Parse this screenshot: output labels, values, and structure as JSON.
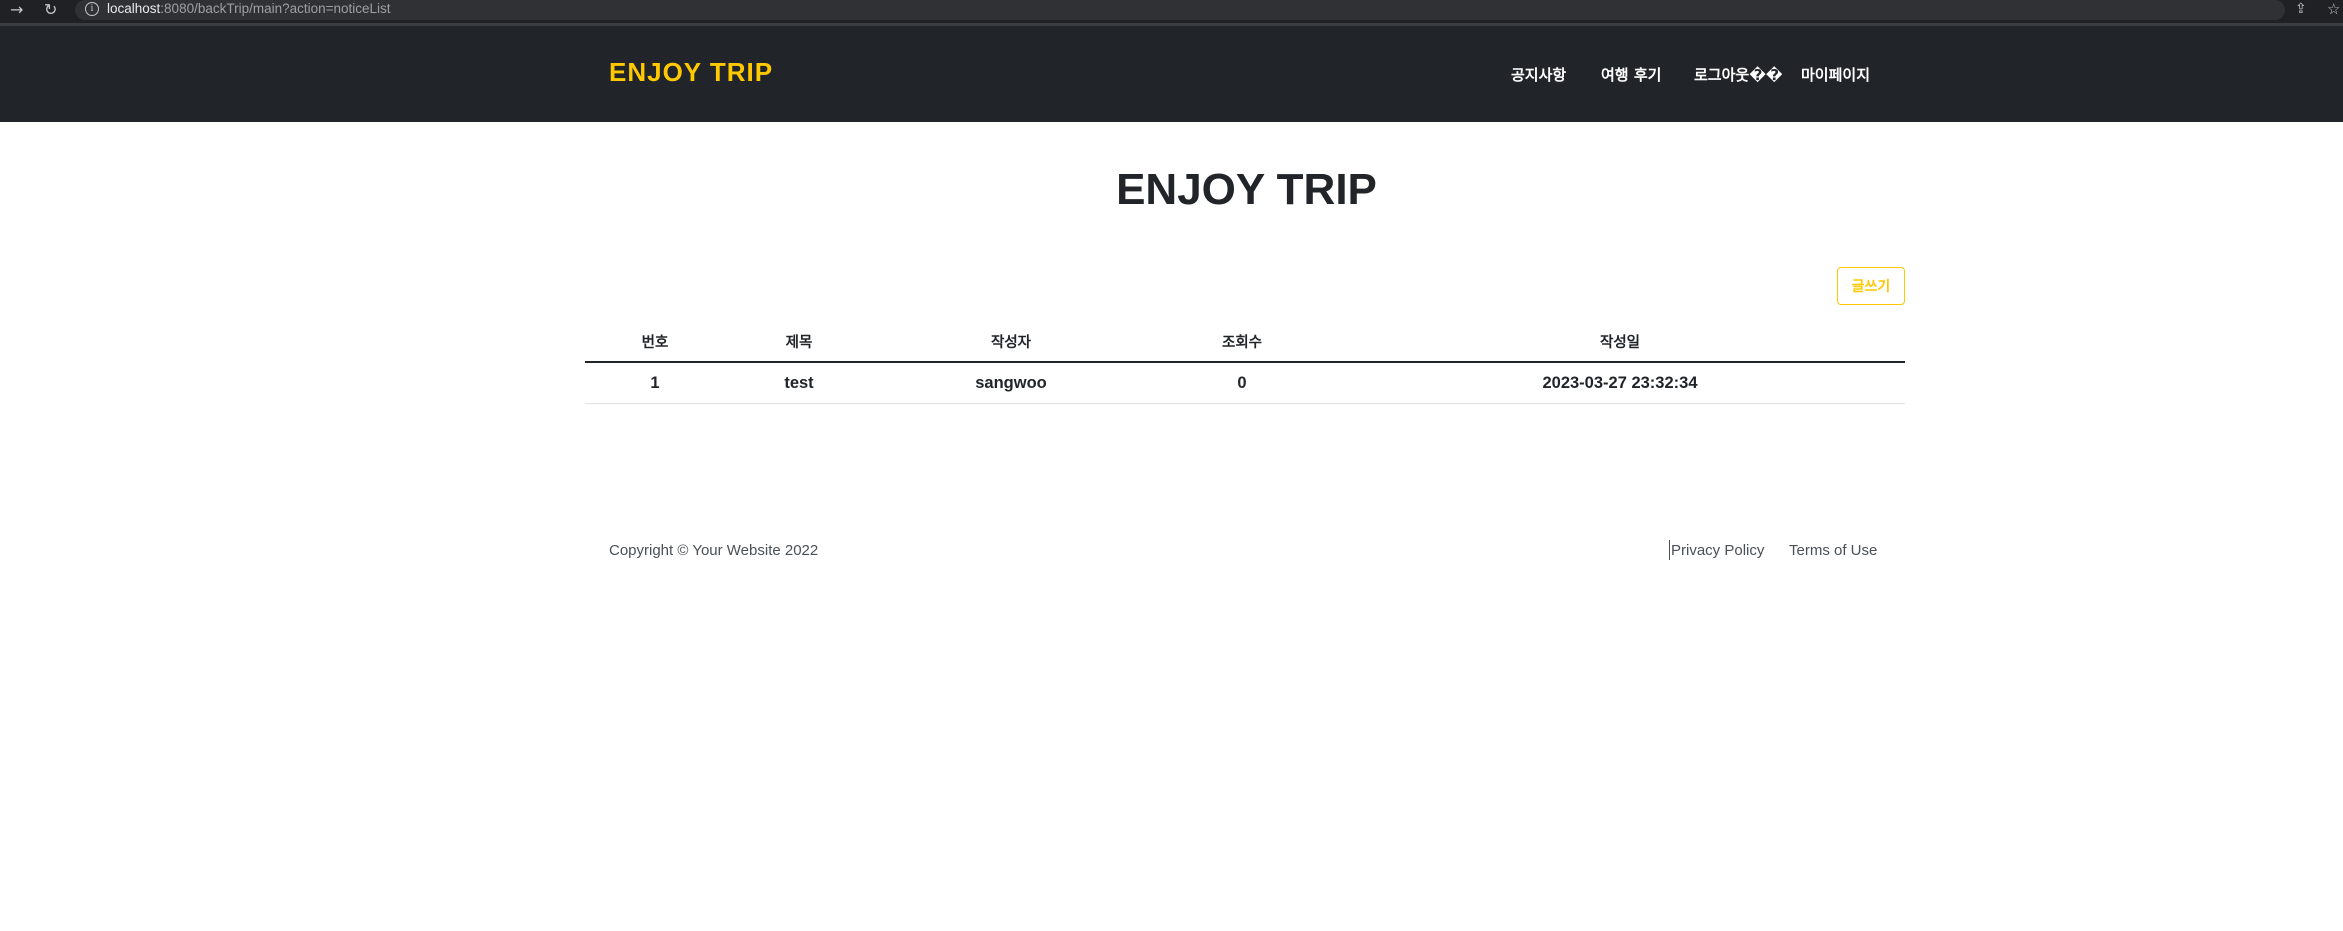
{
  "browser": {
    "url_host": "localhost",
    "url_rest": ":8080/backTrip/main?action=noticeList"
  },
  "navbar": {
    "brand": "ENJOY TRIP",
    "items": [
      {
        "label": "공지사항"
      },
      {
        "label": "여행 후기"
      },
      {
        "label": "로그아웃��"
      },
      {
        "label": "마이페이지"
      }
    ]
  },
  "main": {
    "title": "ENJOY TRIP",
    "write_button": "글쓰기",
    "table": {
      "columns": [
        "번호",
        "제목",
        "작성자",
        "조회수",
        "작성일"
      ],
      "rows": [
        [
          "1",
          "test",
          "sangwoo",
          "0",
          "2023-03-27 23:32:34"
        ]
      ]
    }
  },
  "footer": {
    "copyright": "Copyright © Your Website 2022",
    "links": [
      "Privacy Policy",
      "Terms of Use"
    ]
  },
  "colors": {
    "brand_accent": "#ffc800",
    "navbar_bg": "#212529"
  },
  "icons": [
    "back-arrow-icon",
    "reload-icon",
    "info-icon",
    "share-icon",
    "star-icon"
  ]
}
